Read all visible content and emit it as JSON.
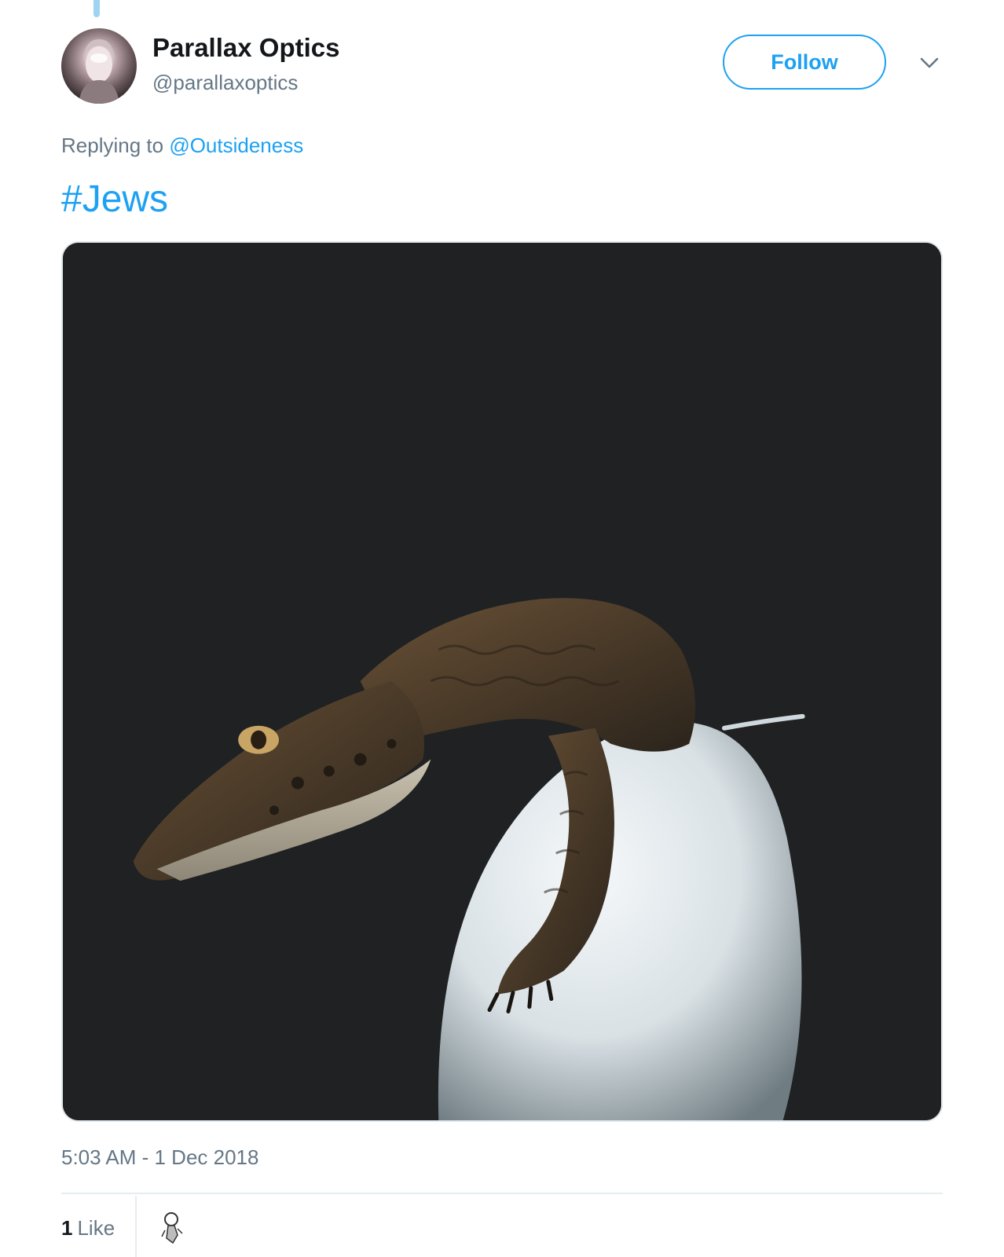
{
  "tweet": {
    "author": {
      "display_name": "Parallax Optics",
      "handle": "@parallaxoptics"
    },
    "follow_label": "Follow",
    "replying_prefix": "Replying to",
    "replying_to": "@Outsideness",
    "text": "#Jews",
    "timestamp": "5:03 AM - 1 Dec 2018",
    "likes": {
      "count": "1",
      "label": "Like"
    }
  },
  "icons": {
    "more": "chevron-down-icon"
  },
  "colors": {
    "accent": "#1da1f2",
    "secondary_text": "#657786",
    "primary_text": "#14171a",
    "thread_line": "#9fd3f4"
  }
}
